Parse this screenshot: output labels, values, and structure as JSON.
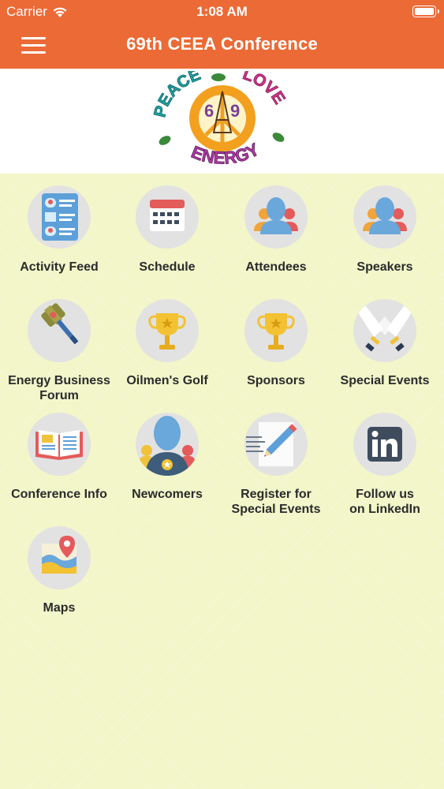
{
  "status_bar": {
    "carrier": "Carrier",
    "time": "1:08 AM"
  },
  "nav": {
    "title": "69th CEEA Conference",
    "menu_icon": "hamburger-menu-icon"
  },
  "banner": {
    "logo_text_top_left": "PEACE",
    "logo_text_top_right": "LOVE",
    "logo_text_bottom": "ENERGY",
    "logo_number": "69",
    "colors": {
      "orange": "#f3a01f",
      "purple": "#7a3f98",
      "teal": "#1fa3a5",
      "pink": "#d6338c",
      "green": "#3a8a3a"
    }
  },
  "colors": {
    "header": "#ec6a35",
    "background": "#f2f6c9",
    "tile_circle": "#e2e2e2"
  },
  "tiles": [
    {
      "label": "Activity Feed",
      "icon": "activity-feed-icon"
    },
    {
      "label": "Schedule",
      "icon": "calendar-icon"
    },
    {
      "label": "Attendees",
      "icon": "attendees-icon"
    },
    {
      "label": "Speakers",
      "icon": "speakers-icon"
    },
    {
      "label": "Energy Business\nForum",
      "icon": "gavel-icon"
    },
    {
      "label": "Oilmen's Golf",
      "icon": "trophy-icon"
    },
    {
      "label": "Sponsors",
      "icon": "trophy-icon"
    },
    {
      "label": "Special Events",
      "icon": "toast-glasses-icon"
    },
    {
      "label": "Conference Info",
      "icon": "open-book-icon"
    },
    {
      "label": "Newcomers",
      "icon": "newcomer-medal-icon"
    },
    {
      "label": "Register for\nSpecial Events",
      "icon": "pencil-register-icon"
    },
    {
      "label": "Follow us\non LinkedIn",
      "icon": "linkedin-icon"
    },
    {
      "label": "Maps",
      "icon": "map-pin-icon"
    }
  ]
}
